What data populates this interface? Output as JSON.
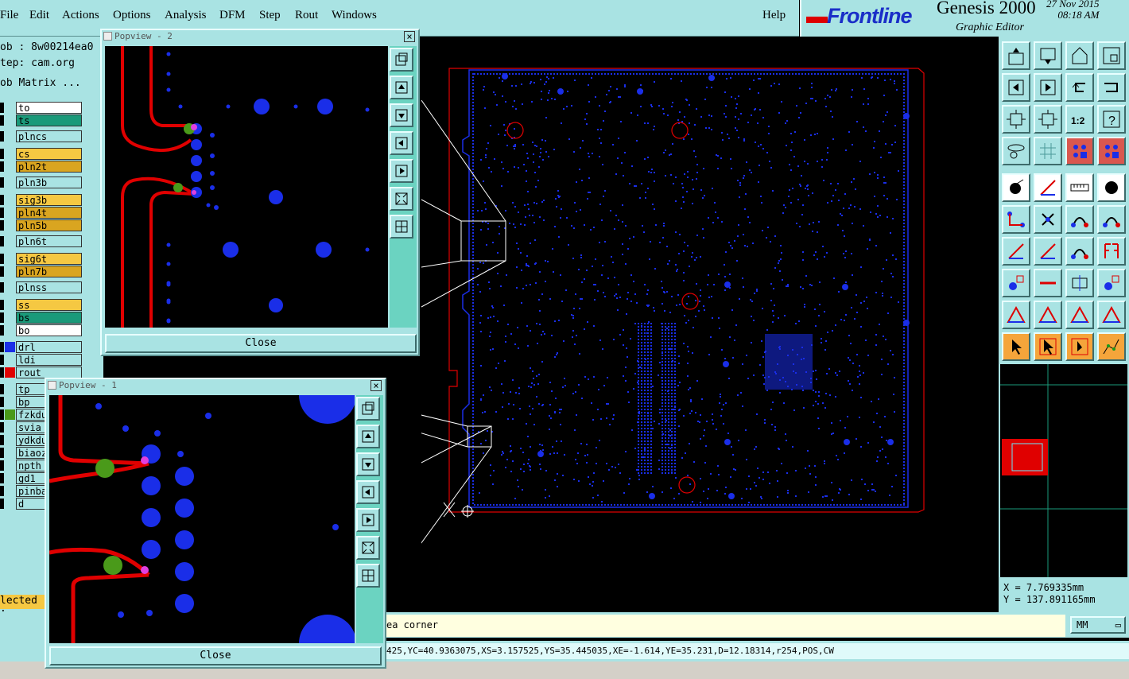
{
  "menu": {
    "file": "File",
    "edit": "Edit",
    "actions": "Actions",
    "options": "Options",
    "analysis": "Analysis",
    "dfm": "DFM",
    "step": "Step",
    "rout": "Rout",
    "windows": "Windows",
    "help": "Help"
  },
  "brand": {
    "logo": "Frontline",
    "product": "Genesis 2000",
    "subtitle": "Graphic Editor",
    "date": "27 Nov 2015",
    "time": "08:18 AM"
  },
  "job": {
    "job_line": "ob : 8w00214ea0",
    "step_line": "tep: cam.org",
    "matrix_line": "ob Matrix ..."
  },
  "layers": [
    {
      "name": "to",
      "color": "#ffffff",
      "swatch": ""
    },
    {
      "name": "ts",
      "color": "#1a9a7a",
      "swatch": ""
    },
    {
      "name": "plncs",
      "color": "#a9e3e3",
      "swatch": ""
    },
    {
      "name": "cs",
      "color": "#f5c842",
      "swatch": ""
    },
    {
      "name": "pln2t",
      "color": "#d9a520",
      "swatch": ""
    },
    {
      "name": "pln3b",
      "color": "#a9e3e3",
      "swatch": ""
    },
    {
      "name": "sig3b",
      "color": "#f5c842",
      "swatch": ""
    },
    {
      "name": "pln4t",
      "color": "#d9a520",
      "swatch": ""
    },
    {
      "name": "pln5b",
      "color": "#d9a520",
      "swatch": ""
    },
    {
      "name": "pln6t",
      "color": "#a9e3e3",
      "swatch": ""
    },
    {
      "name": "sig6t",
      "color": "#f5c842",
      "swatch": ""
    },
    {
      "name": "pln7b",
      "color": "#d9a520",
      "swatch": ""
    },
    {
      "name": "plnss",
      "color": "#a9e3e3",
      "swatch": ""
    },
    {
      "name": "ss",
      "color": "#f5c842",
      "swatch": ""
    },
    {
      "name": "bs",
      "color": "#1a9a7a",
      "swatch": ""
    },
    {
      "name": "bo",
      "color": "#ffffff",
      "swatch": ""
    },
    {
      "name": "drl",
      "color": "#a9e3e3",
      "swatch": "#1a2ee8"
    },
    {
      "name": "ldi",
      "color": "#a9e3e3",
      "swatch": ""
    },
    {
      "name": "rout",
      "color": "#a9e3e3",
      "swatch": "#e00000"
    },
    {
      "name": "tp",
      "color": "#a9e3e3",
      "swatch": ""
    },
    {
      "name": "bp",
      "color": "#a9e3e3",
      "swatch": ""
    },
    {
      "name": "fzkdu",
      "color": "#a9e3e3",
      "swatch": "#4a9a1a"
    },
    {
      "name": "svia",
      "color": "#a9e3e3",
      "swatch": ""
    },
    {
      "name": "ydkdu",
      "color": "#a9e3e3",
      "swatch": ""
    },
    {
      "name": "biaoz",
      "color": "#a9e3e3",
      "swatch": ""
    },
    {
      "name": "npth",
      "color": "#a9e3e3",
      "swatch": ""
    },
    {
      "name": "gd1",
      "color": "#a9e3e3",
      "swatch": ""
    },
    {
      "name": "pinba",
      "color": "#a9e3e3",
      "swatch": ""
    },
    {
      "name": "d",
      "color": "#a9e3e3",
      "swatch": ""
    }
  ],
  "selected_label": "lected :",
  "popview2": {
    "title": "Popview - 2",
    "close": "Close"
  },
  "popview1": {
    "title": "Popview - 1",
    "close": "Close"
  },
  "coords": {
    "x": "X = 7.769335mm",
    "y": "Y = 137.891165mm"
  },
  "message": "ea corner",
  "units": "MM",
  "info": "425,YC=40.9363075,XS=3.157525,YS=35.445035,XE=-1.614,YE=35.231,D=12.18314,r254,POS,CW",
  "colors": {
    "panel": "#a9e3e3",
    "pad": "#1a2ee8",
    "rout": "#e00000",
    "mask": "#4a9a1a"
  }
}
